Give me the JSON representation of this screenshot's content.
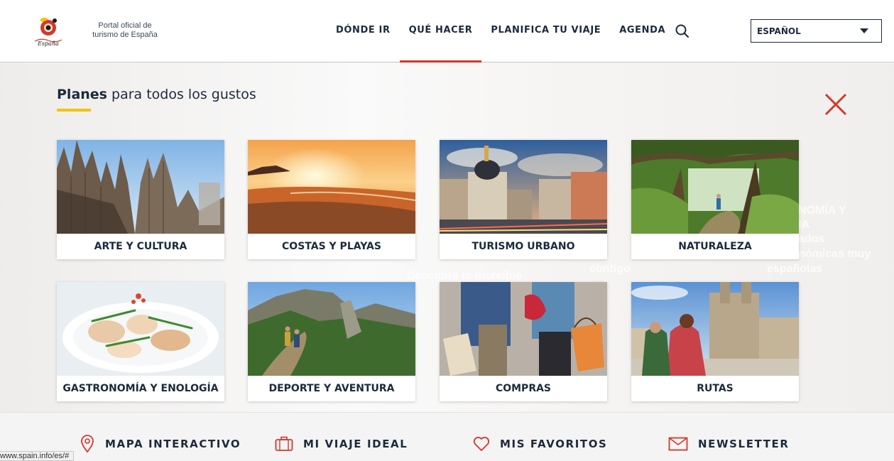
{
  "header": {
    "tagline": "Portal oficial de turismo de España",
    "logo_text": "España",
    "nav": [
      "DÓNDE IR",
      "QUÉ HACER",
      "PLANIFICA TU VIAJE",
      "AGENDA"
    ],
    "active_nav": "QUÉ HACER",
    "language": "ESPAÑOL"
  },
  "panel": {
    "title_bold": "Planes",
    "title_rest": " para todos los gustos",
    "cards": [
      {
        "label": "ARTE Y CULTURA",
        "image": "sagrada-familia-photo"
      },
      {
        "label": "COSTAS Y PLAYAS",
        "image": "beach-sunset-photo"
      },
      {
        "label": "TURISMO URBANO",
        "image": "madrid-gran-via-photo"
      },
      {
        "label": "NATURALEZA",
        "image": "forest-hiker-photo"
      },
      {
        "label": "GASTRONOMÍA Y ENOLOGÍA",
        "image": "squid-dish-photo"
      },
      {
        "label": "DEPORTE Y AVENTURA",
        "image": "mountain-hikers-photo"
      },
      {
        "label": "COMPRAS",
        "image": "shopping-couple-photo"
      },
      {
        "label": "RUTAS",
        "image": "santiago-cathedral-photo"
      }
    ]
  },
  "background_text": {
    "descubre": "Descubre lo increíble",
    "gastro": "NOMÍA Y",
    "gastro2": "IA",
    "gastro3": "ados",
    "gastro4": "nómicas muy",
    "gastro5": "españolas",
    "contigo": "contigo"
  },
  "footer": {
    "items": [
      {
        "label": "MAPA INTERACTIVO",
        "icon": "map-pin-icon"
      },
      {
        "label": "MI VIAJE IDEAL",
        "icon": "suitcase-icon"
      },
      {
        "label": "MIS FAVORITOS",
        "icon": "heart-icon"
      },
      {
        "label": "NEWSLETTER",
        "icon": "envelope-icon"
      }
    ]
  },
  "status_url": "www.spain.info/es/#",
  "colors": {
    "accent_red": "#d4372b",
    "underline_yellow": "#f2c300",
    "text_navy": "#1c2a3d"
  }
}
